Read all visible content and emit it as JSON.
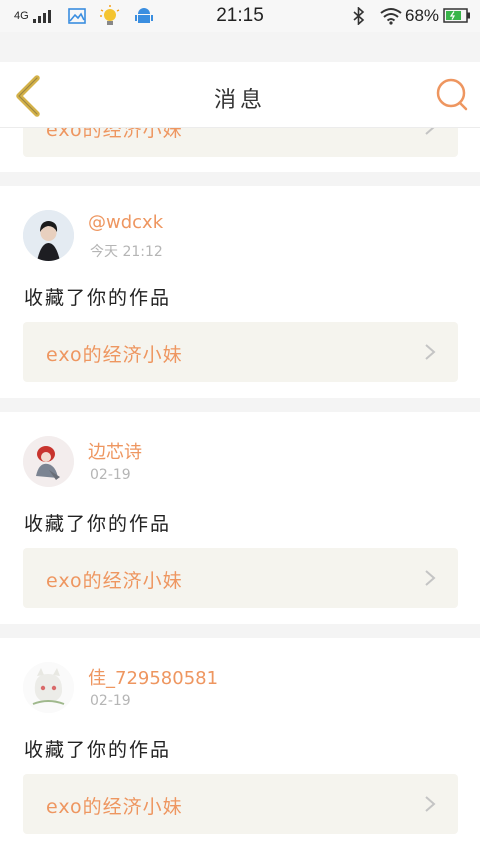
{
  "status_bar": {
    "network": "4G",
    "time": "21:15",
    "battery": "68%"
  },
  "nav": {
    "title": "消息"
  },
  "top_partial": {
    "work_title": "exo的经济小妹"
  },
  "messages": [
    {
      "username": "@wdcxk",
      "time": "今天 21:12",
      "action": "收藏了你的作品",
      "work_title": "exo的经济小妹"
    },
    {
      "username": "边芯诗",
      "time": "02-19",
      "action": "收藏了你的作品",
      "work_title": "exo的经济小妹"
    },
    {
      "username": "佳_729580581",
      "time": "02-19",
      "action": "收藏了你的作品",
      "work_title": "exo的经济小妹"
    }
  ],
  "colors": {
    "accent": "#ee9660",
    "back_arrow": "#d4b24a",
    "link_bg": "#f5f4ee"
  },
  "icons": [
    "signal-icon",
    "gallery-icon",
    "bulb-icon",
    "android-icon",
    "bluetooth-icon",
    "wifi-icon",
    "battery-icon",
    "back-arrow-icon",
    "search-icon",
    "chevron-right-icon"
  ]
}
